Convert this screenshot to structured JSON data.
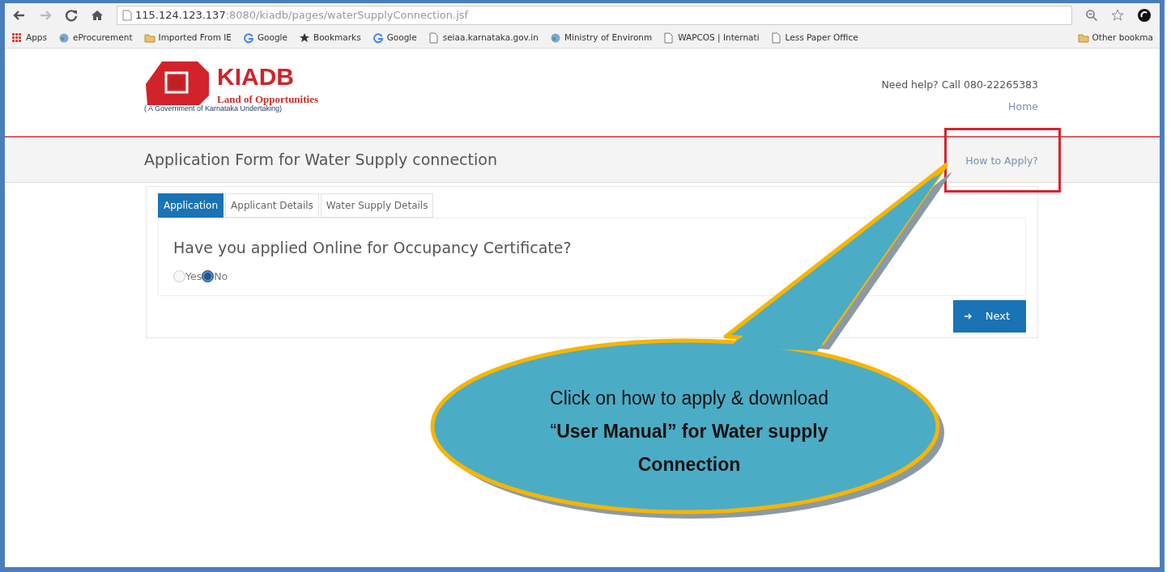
{
  "browser": {
    "url_host": "115.124.123.137",
    "url_path": ":8080/kiadb/pages/waterSupplyConnection.jsf",
    "bookmarks": [
      {
        "kind": "apps",
        "label": "Apps"
      },
      {
        "kind": "globe",
        "label": "eProcurement"
      },
      {
        "kind": "folder",
        "label": "Imported From IE"
      },
      {
        "kind": "google",
        "label": "Google"
      },
      {
        "kind": "star",
        "label": "Bookmarks"
      },
      {
        "kind": "google",
        "label": "Google"
      },
      {
        "kind": "page",
        "label": "seiaa.karnataka.gov.in"
      },
      {
        "kind": "globe",
        "label": "Ministry of Environm"
      },
      {
        "kind": "page",
        "label": "WAPCOS | Internati"
      },
      {
        "kind": "page",
        "label": "Less Paper Office"
      }
    ],
    "other_bookmarks": "Other bookma"
  },
  "header": {
    "logo_title": "KIADB",
    "logo_tagline": "Land of Opportunities",
    "logo_subtitle": "( A Government of Karnataka Undertaking)",
    "help_text": "Need help? Call 080-22265383",
    "home_link": "Home"
  },
  "title_bar": {
    "title": "Application Form for Water Supply connection",
    "help_link": "How to Apply?",
    "help_link_highlighted": true
  },
  "tabs": [
    {
      "label": "Application",
      "selected": true
    },
    {
      "label": "Applicant Details",
      "selected": false
    },
    {
      "label": "Water Supply Details",
      "selected": false
    }
  ],
  "question": "Have you applied Online for Occupancy Certificate?",
  "options": [
    {
      "label": "Yes",
      "selected": false
    },
    {
      "label": "No",
      "selected": true
    }
  ],
  "next_button": "Next",
  "callout": {
    "text": "Click on how to apply & download “**User Manual” for Water supply Connection**"
  }
}
